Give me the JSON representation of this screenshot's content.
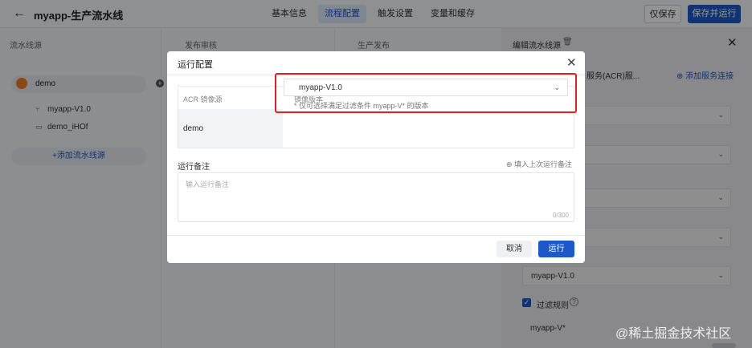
{
  "topbar": {
    "back_icon": "arrow-left-icon",
    "title": "myapp-生产流水线",
    "tabs": [
      {
        "label": "基本信息",
        "active": false
      },
      {
        "label": "流程配置",
        "active": true
      },
      {
        "label": "触发设置",
        "active": false
      },
      {
        "label": "变量和缓存",
        "active": false
      }
    ],
    "save_only": "仅保存",
    "save_and_run": "保存并运行"
  },
  "columns": {
    "source_header": "流水线源",
    "review_header": "发布审核",
    "prod_header": "生产发布"
  },
  "source": {
    "name": "demo",
    "branch": "myapp-V1.0",
    "repo": "demo_iHOf",
    "add_label": "+添加流水线源"
  },
  "right_panel": {
    "title": "编辑流水线源",
    "acr_label": "服务(ACR)服...",
    "add_connection": "添加服务连接",
    "version_value": "myapp-V1.0",
    "filter_label": "过滤规则",
    "filter_value": "myapp-V*"
  },
  "modal": {
    "title": "运行配置",
    "col_acr": "ACR 镜像源",
    "col_version": "镜像版本",
    "row_name": "demo",
    "selected_version": "myapp-V1.0",
    "hint": "* 仅可选择满足过滤条件 myapp-V* 的版本",
    "note_label": "运行备注",
    "fill_last": "填入上次运行备注",
    "note_placeholder": "输入运行备注",
    "note_count": "0/300",
    "cancel": "取消",
    "run": "运行"
  },
  "watermark": "@稀土掘金技术社区",
  "colors": {
    "primary": "#1d58c9",
    "highlight_border": "#e02020"
  }
}
